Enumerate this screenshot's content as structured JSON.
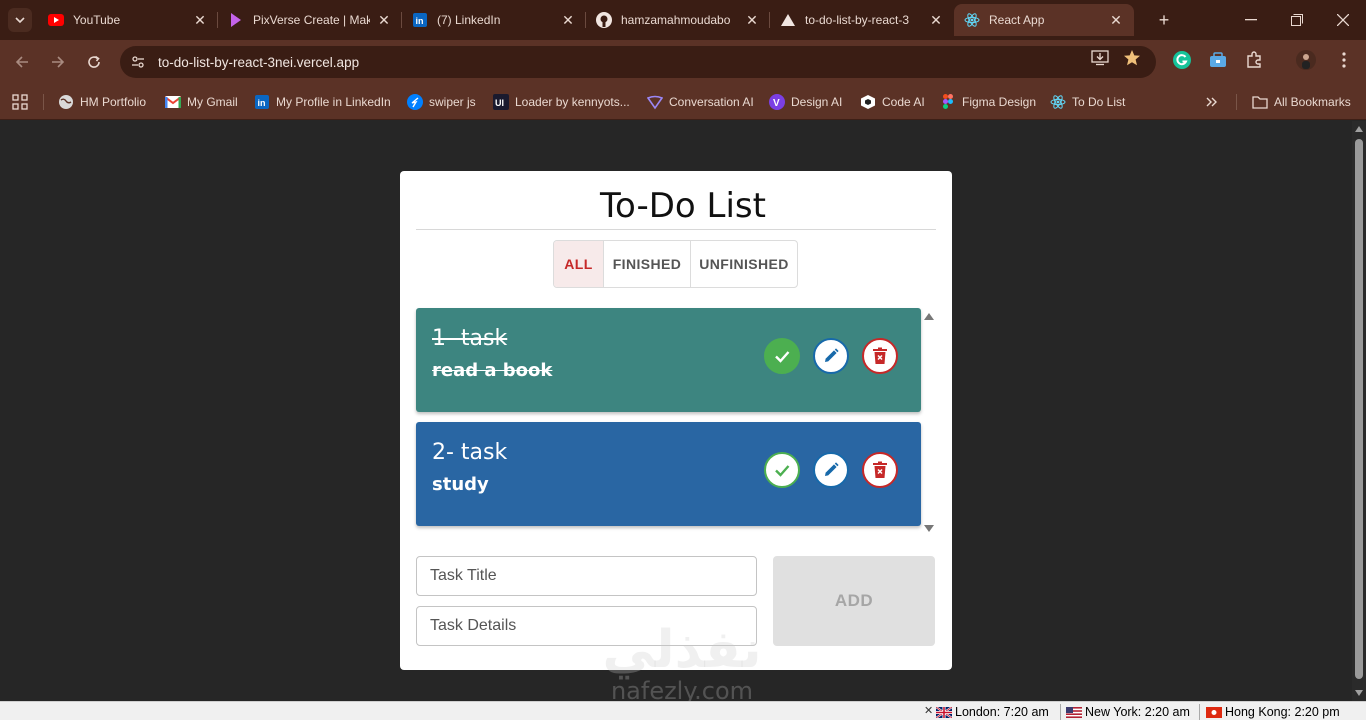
{
  "browser": {
    "tabs": [
      {
        "title": "YouTube",
        "icon": "youtube-icon"
      },
      {
        "title": "PixVerse Create | Mak",
        "icon": "pixverse-icon"
      },
      {
        "title": "(7) LinkedIn",
        "icon": "linkedin-icon"
      },
      {
        "title": "hamzamahmoudabo",
        "icon": "github-icon"
      },
      {
        "title": "to-do-list-by-react-3",
        "icon": "vercel-icon"
      },
      {
        "title": "React App",
        "icon": "react-icon",
        "active": true
      }
    ],
    "url": "to-do-list-by-react-3nei.vercel.app",
    "bookmarks": [
      {
        "label": "HM Portfolio",
        "icon": "globe-icon"
      },
      {
        "label": "My Gmail",
        "icon": "gmail-icon"
      },
      {
        "label": "My Profile in LinkedIn",
        "icon": "linkedin-icon"
      },
      {
        "label": "swiper js",
        "icon": "swiper-icon"
      },
      {
        "label": "Loader by kennyots...",
        "icon": "uiverse-icon"
      },
      {
        "label": "Conversation AI",
        "icon": "ai-icon"
      },
      {
        "label": "Design AI",
        "icon": "v-icon"
      },
      {
        "label": "Code AI",
        "icon": "cube-icon"
      },
      {
        "label": "Figma Design",
        "icon": "figma-icon"
      },
      {
        "label": "To Do List",
        "icon": "react-icon"
      }
    ],
    "all_bookmarks": "All Bookmarks"
  },
  "app": {
    "title": "To-Do List",
    "filters": [
      {
        "label": "ALL",
        "active": true
      },
      {
        "label": "FINISHED",
        "active": false
      },
      {
        "label": "UNFINISHED",
        "active": false
      }
    ],
    "tasks": [
      {
        "title": "1- task",
        "details": "read a book",
        "completed": true
      },
      {
        "title": "2- task",
        "details": "study",
        "completed": false
      }
    ],
    "form": {
      "title_placeholder": "Task Title",
      "details_placeholder": "Task Details",
      "add_label": "ADD"
    },
    "watermark": {
      "line1": "نفذلي",
      "line2": "nafezly.com"
    }
  },
  "clocks": [
    {
      "label": "London: 7:20 am",
      "flag": "uk"
    },
    {
      "label": "New York: 2:20 am",
      "flag": "us"
    },
    {
      "label": "Hong Kong: 2:20 pm",
      "flag": "hk"
    }
  ],
  "colors": {
    "tab_bar": "#3a1d14",
    "toolbar": "#5b3226",
    "task_completed": "#3d8580",
    "task_pending": "#2966a3",
    "filter_active": "#c62828"
  }
}
